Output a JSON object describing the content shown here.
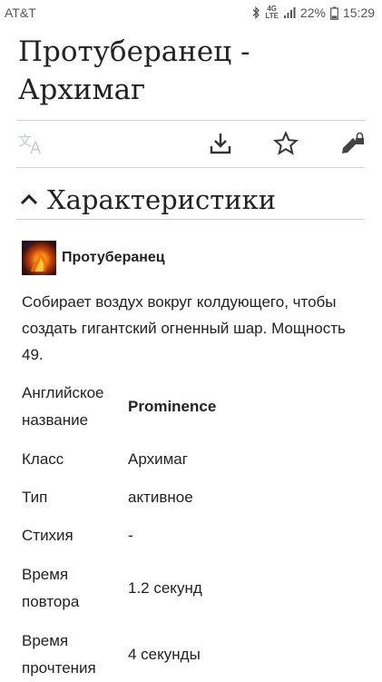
{
  "status_bar": {
    "carrier": "AT&T",
    "network": "4G",
    "network_sub": "LTE",
    "battery": "22%",
    "time": "15:29"
  },
  "page": {
    "title": "Протуберанец - Архимаг"
  },
  "toolbar": {
    "translate_icon": "translate-icon",
    "download_icon": "download-icon",
    "star_icon": "star-icon",
    "edit_icon": "edit-locked-icon"
  },
  "section": {
    "title": "Характеристики",
    "collapse_icon": "chevron-up-icon"
  },
  "skill": {
    "name": "Протуберанец",
    "description": "Собирает воздух вокруг колдующего, чтобы создать гигантский огненный шар. Мощность 49."
  },
  "properties": [
    {
      "label": "Английское название",
      "value": "Prominence"
    },
    {
      "label": "Класс",
      "value": "Архимаг"
    },
    {
      "label": "Тип",
      "value": "активное"
    },
    {
      "label": "Стихия",
      "value": "-"
    },
    {
      "label": "Время повтора",
      "value": "1.2 секунд"
    },
    {
      "label": "Время прочтения",
      "value": "4 секунды"
    }
  ]
}
